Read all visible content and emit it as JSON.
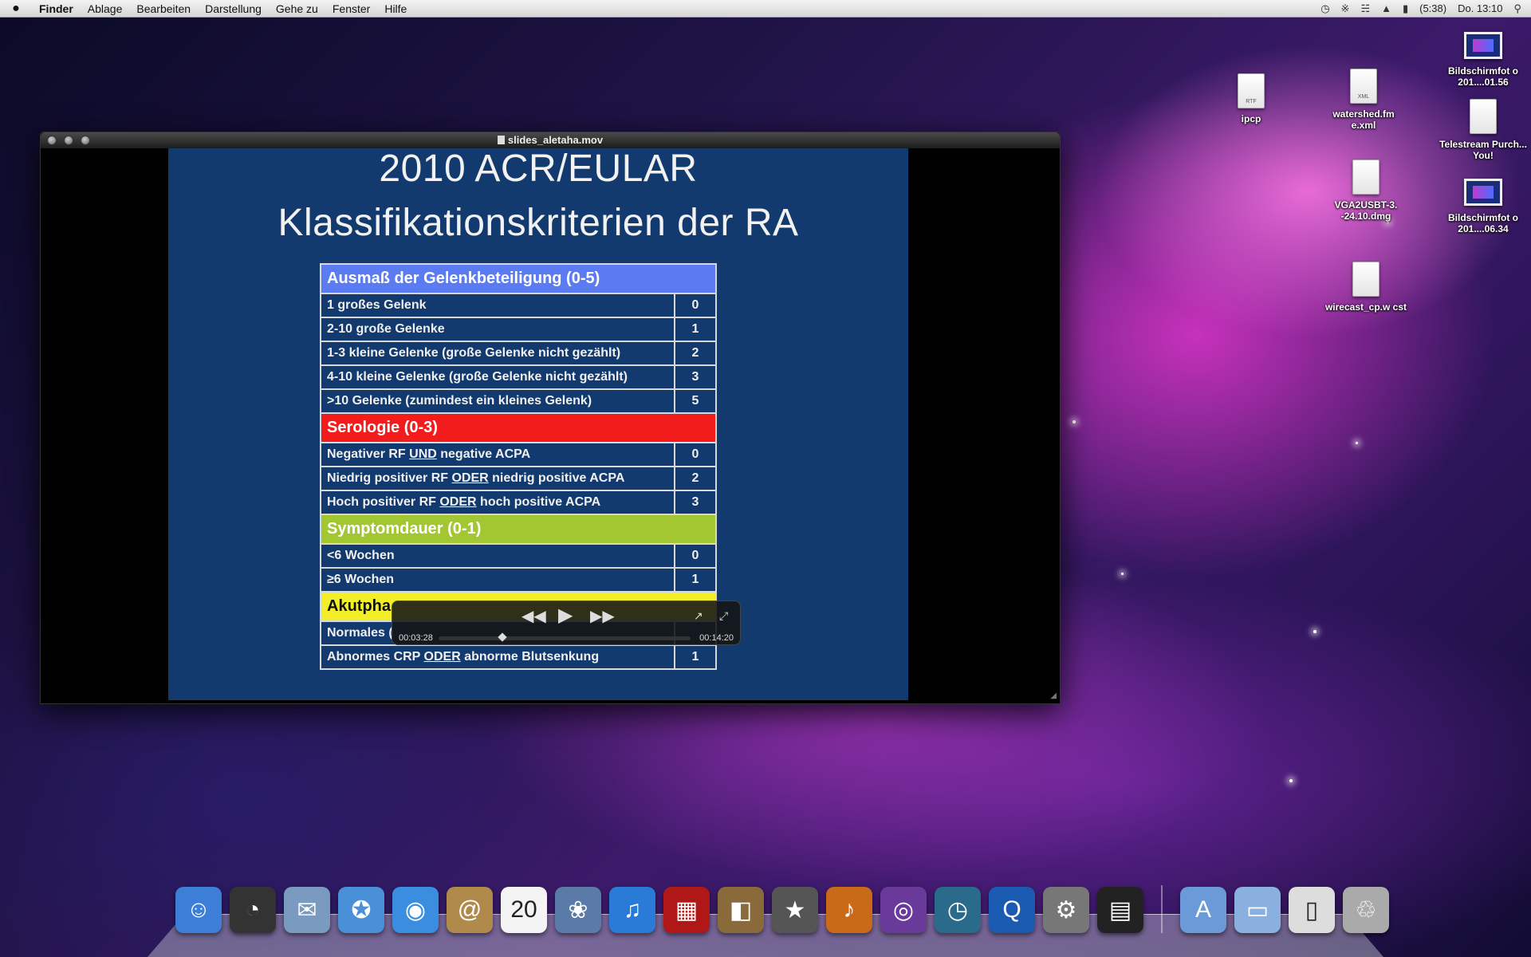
{
  "menubar": {
    "app_name": "Finder",
    "items": [
      "Ablage",
      "Bearbeiten",
      "Darstellung",
      "Gehe zu",
      "Fenster",
      "Hilfe"
    ],
    "battery_time": "(5:38)",
    "clock": "Do. 13:10",
    "status_icons": [
      "time-machine-icon",
      "bluetooth-icon",
      "wifi-icon",
      "volume-icon",
      "battery-icon",
      "spotlight-icon"
    ]
  },
  "desktop_icons": [
    {
      "label": "Bildschirmfot o 201....01.56",
      "kind": "screenshot"
    },
    {
      "label": "ipcp",
      "kind": "rtf",
      "tag": "RTF"
    },
    {
      "label": "watershed.fm e.xml",
      "kind": "xml",
      "tag": "XML"
    },
    {
      "label": "Telestream Purch... You!",
      "kind": "doc"
    },
    {
      "label": "VGA2USBT-3. -24.10.dmg",
      "kind": "dmg"
    },
    {
      "label": "Bildschirmfot o 201....06.34",
      "kind": "screenshot"
    },
    {
      "label": "wirecast_cp.w cst",
      "kind": "wcst"
    }
  ],
  "window": {
    "title": "slides_aletaha.mov"
  },
  "slide": {
    "title_line1": "2010 ACR/EULAR",
    "title_line2": "Klassifikationskriterien der RA",
    "sections": {
      "joints": {
        "header": "Ausmaß der Gelenkbeteiligung (0-5)",
        "rows": [
          {
            "label": "1 großes Gelenk",
            "points": "0"
          },
          {
            "label": "2-10 große Gelenke",
            "points": "1"
          },
          {
            "label": "1-3 kleine Gelenke (große Gelenke nicht gezählt)",
            "points": "2"
          },
          {
            "label": "4-10 kleine Gelenke (große Gelenke nicht gezählt)",
            "points": "3"
          },
          {
            "label": ">10 Gelenke (zumindest ein kleines Gelenk)",
            "points": "5"
          }
        ]
      },
      "serology": {
        "header": "Serologie (0-3)",
        "row1": {
          "a": "Negativer RF ",
          "u": "UND",
          "b": " negative ACPA",
          "points": "0"
        },
        "row2": {
          "a": "Niedrig positiver RF ",
          "u": "ODER",
          "b": " niedrig positive ACPA",
          "points": "2"
        },
        "row3": {
          "a": "Hoch positiver RF ",
          "u": "ODER",
          "b": " hoch positive ACPA",
          "points": "3"
        }
      },
      "duration": {
        "header": "Symptomdauer (0-1)",
        "rows": [
          {
            "label": "<6 Wochen",
            "points": "0"
          },
          {
            "label": "≥6 Wochen",
            "points": "1"
          }
        ]
      },
      "acute": {
        "header": "Akutpha",
        "row1": {
          "label": "Normales (",
          "points": ""
        },
        "row2": {
          "a": "Abnormes CRP ",
          "u": "ODER",
          "b": " abnorme Blutsenkung",
          "points": "1"
        }
      }
    }
  },
  "hud": {
    "elapsed": "00:03:28",
    "total": "00:14:20",
    "progress": 0.242
  },
  "dock": {
    "apps": [
      {
        "name": "finder-icon",
        "glyph": "☺",
        "color": "#3d7fd6"
      },
      {
        "name": "dashboard-icon",
        "glyph": "◔",
        "color": "#333"
      },
      {
        "name": "mail-icon",
        "glyph": "✉",
        "color": "#7a9bbf"
      },
      {
        "name": "safari-icon",
        "glyph": "✪",
        "color": "#4a90d9"
      },
      {
        "name": "ichat-icon",
        "glyph": "◉",
        "color": "#3b8de0"
      },
      {
        "name": "address-book-icon",
        "glyph": "@",
        "color": "#b08a4a"
      },
      {
        "name": "ical-icon",
        "glyph": "20",
        "color": "#f4f4f4"
      },
      {
        "name": "iphoto-icon",
        "glyph": "❀",
        "color": "#5a7aa8"
      },
      {
        "name": "itunes-icon",
        "glyph": "♫",
        "color": "#2a7ad8"
      },
      {
        "name": "photo-booth-icon",
        "glyph": "▦",
        "color": "#b01818"
      },
      {
        "name": "image-capture-icon",
        "glyph": "◧",
        "color": "#8a6a3a"
      },
      {
        "name": "imovie-icon",
        "glyph": "★",
        "color": "#555"
      },
      {
        "name": "garageband-icon",
        "glyph": "♪",
        "color": "#c86a18"
      },
      {
        "name": "podcast-icon",
        "glyph": "◎",
        "color": "#6a3a9a"
      },
      {
        "name": "time-machine-dock-icon",
        "glyph": "◷",
        "color": "#2a6a8a"
      },
      {
        "name": "quicktime-icon",
        "glyph": "Q",
        "color": "#1a5ab0"
      },
      {
        "name": "system-preferences-icon",
        "glyph": "⚙",
        "color": "#777"
      },
      {
        "name": "final-cut-icon",
        "glyph": "▤",
        "color": "#222"
      }
    ],
    "stacks": [
      {
        "name": "applications-folder-icon",
        "glyph": "A",
        "color": "#6a9ad8"
      },
      {
        "name": "documents-folder-icon",
        "glyph": "▭",
        "color": "#8ab0e0"
      },
      {
        "name": "downloads-icon",
        "glyph": "▯",
        "color": "#ddd"
      },
      {
        "name": "trash-icon",
        "glyph": "♲",
        "color": "#aaa"
      }
    ]
  }
}
